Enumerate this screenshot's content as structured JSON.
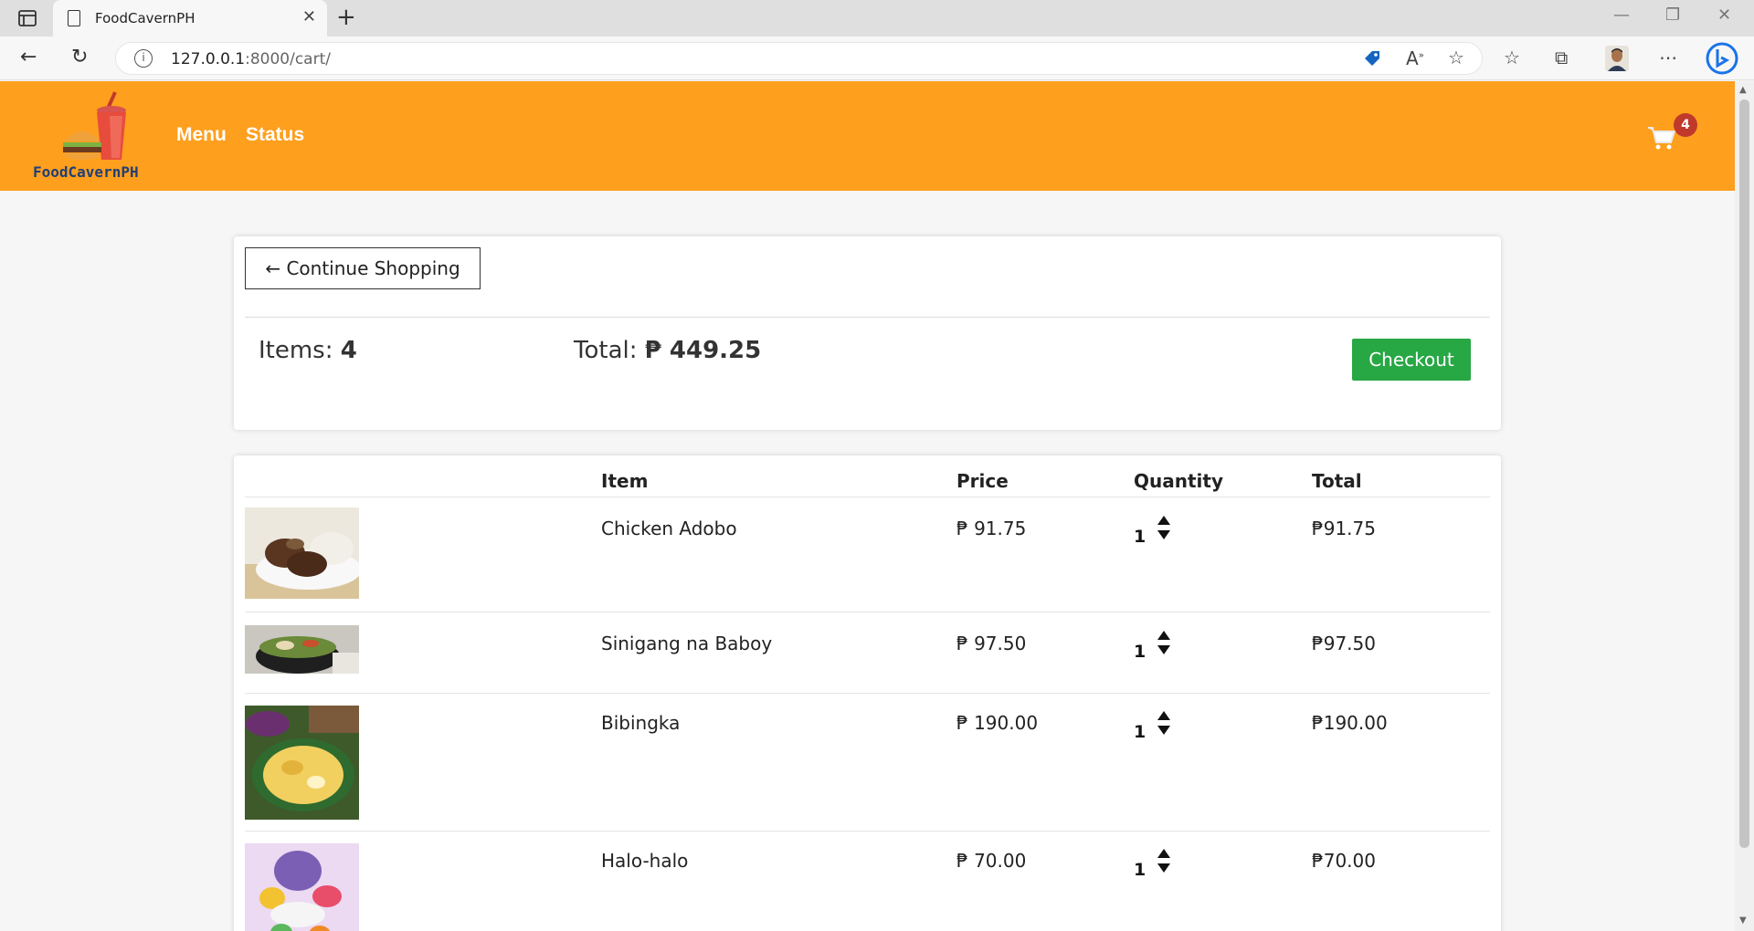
{
  "browser": {
    "tab_title": "FoodCavernPH",
    "url_host": "127.0.0.1",
    "url_rest": ":8000/cart/"
  },
  "site": {
    "logo_text": "FoodCavernPH",
    "nav": [
      "Menu",
      "Status"
    ],
    "cart_count": "4"
  },
  "summary": {
    "continue_label": "← Continue Shopping",
    "items_label": "Items: ",
    "items_value": "4",
    "total_label": "Total: ",
    "total_value": "₱ 449.25",
    "checkout_label": "Checkout"
  },
  "table": {
    "headers": [
      "Item",
      "Price",
      "Quantity",
      "Total"
    ],
    "rows": [
      {
        "name": "Chicken Adobo",
        "price": "₱ 91.75",
        "qty": "1",
        "total": "₱91.75",
        "image": "chicken-adobo-photo"
      },
      {
        "name": "Sinigang na Baboy",
        "price": "₱ 97.50",
        "qty": "1",
        "total": "₱97.50",
        "image": "sinigang-photo"
      },
      {
        "name": "Bibingka",
        "price": "₱ 190.00",
        "qty": "1",
        "total": "₱190.00",
        "image": "bibingka-photo"
      },
      {
        "name": "Halo-halo",
        "price": "₱ 70.00",
        "qty": "1",
        "total": "₱70.00",
        "image": "halo-halo-photo"
      }
    ]
  },
  "colors": {
    "header": "#fe9f1e",
    "checkout": "#28a745",
    "badge": "#c0392b"
  }
}
